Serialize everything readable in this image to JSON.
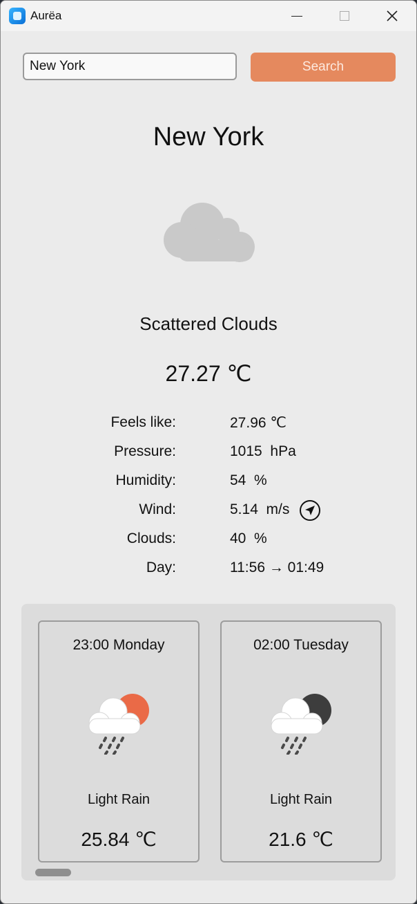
{
  "window": {
    "title": "Aurëa"
  },
  "search": {
    "value": "New York",
    "button_label": "Search"
  },
  "current": {
    "city": "New York",
    "icon": "cloud-icon",
    "description": "Scattered Clouds",
    "temperature": "27.27 ℃",
    "details": [
      {
        "label": "Feels like:",
        "value": "27.96 ℃"
      },
      {
        "label": "Pressure:",
        "value": "1015  hPa"
      },
      {
        "label": "Humidity:",
        "value": "54  %"
      },
      {
        "label": "Wind:",
        "value": "5.14  m/s",
        "icon": "wind-direction-icon"
      },
      {
        "label": "Clouds:",
        "value": "40  %"
      },
      {
        "label": "Day:",
        "value": "11:56 → 01:49"
      }
    ]
  },
  "forecast": [
    {
      "time": "23:00 Monday",
      "icon": "rain-day-icon",
      "description": "Light Rain",
      "temperature": "25.84 ℃"
    },
    {
      "time": "02:00 Tuesday",
      "icon": "rain-night-icon",
      "description": "Light Rain",
      "temperature": "21.6 ℃"
    }
  ],
  "colors": {
    "accent": "#e5895e",
    "sun": "#ea6a47",
    "moon": "#3d3d3d",
    "background": "#ebebeb"
  }
}
